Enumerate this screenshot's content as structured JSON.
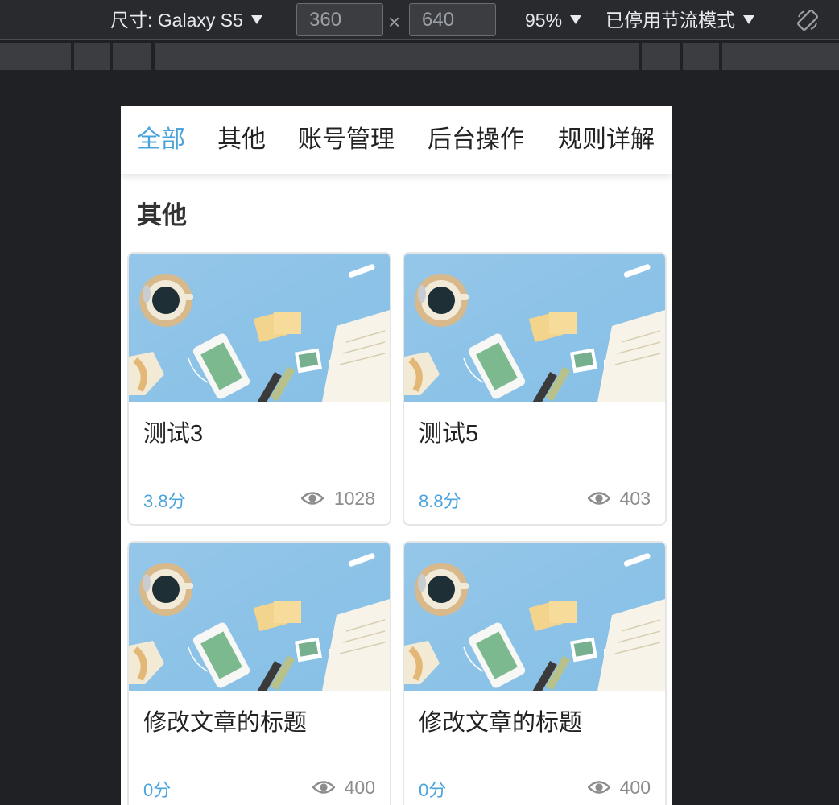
{
  "devtools": {
    "size_label": "尺寸: Galaxy S5",
    "width_value": "360",
    "times_symbol": "×",
    "height_value": "640",
    "zoom_label": "95%",
    "throttle_label": "已停用节流模式"
  },
  "nav": {
    "tabs": [
      {
        "label": "全部",
        "active": true
      },
      {
        "label": "其他",
        "active": false
      },
      {
        "label": "账号管理",
        "active": false
      },
      {
        "label": "后台操作",
        "active": false
      },
      {
        "label": "规则详解",
        "active": false
      }
    ]
  },
  "section": {
    "title": "其他"
  },
  "cards": [
    {
      "title": "测试3",
      "score": "3.8分",
      "views": "1028"
    },
    {
      "title": "测试5",
      "score": "8.8分",
      "views": "403"
    },
    {
      "title": "修改文章的标题",
      "score": "0分",
      "views": "400"
    },
    {
      "title": "修改文章的标题",
      "score": "0分",
      "views": "400"
    }
  ],
  "colors": {
    "accent": "#4ba4dc",
    "thumb_bg": "#86bfe6",
    "devtools_bg": "#292a2d"
  },
  "icons": {
    "view_count": "eye-icon",
    "rotate": "rotate-device-icon"
  }
}
